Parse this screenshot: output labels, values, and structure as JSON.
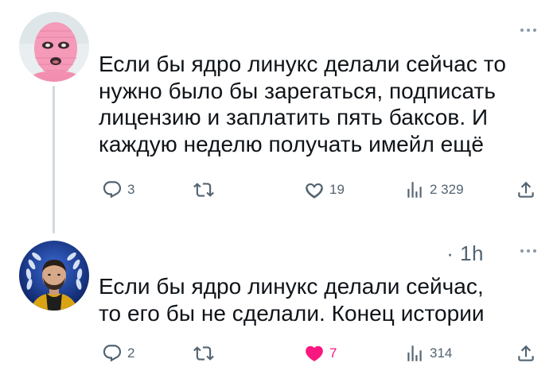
{
  "tweets": [
    {
      "text": "Если бы ядро линукс делали сейчас то\nнужно было бы зарегаться, подписать\nлицензию и заплатить пять баксов. И\nкаждую неделю получать имейл ещё",
      "replies": "3",
      "retweets": "",
      "likes": "19",
      "views": "2 329",
      "liked": false,
      "avatar_icon": "pink-balaclava-avatar"
    },
    {
      "timestamp": "· 1h",
      "text": "Если бы ядро линукс делали сейчас,\nто его бы не сделали. Конец истории",
      "replies": "2",
      "retweets": "",
      "likes": "7",
      "views": "314",
      "liked": true,
      "avatar_icon": "man-laurel-wreath-avatar"
    }
  ],
  "colors": {
    "text": "#0f1419",
    "muted": "#536471",
    "like_active": "#f91880",
    "thread_line": "#cfd9de"
  }
}
